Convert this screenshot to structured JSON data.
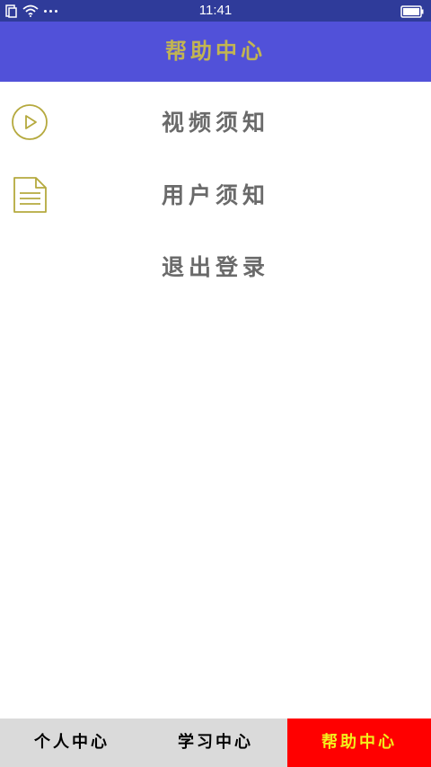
{
  "status_bar": {
    "time": "11:41",
    "icons": [
      "sim-icon",
      "wifi-icon",
      "more-dots-icon",
      "battery-icon"
    ]
  },
  "header": {
    "title": "帮助中心"
  },
  "menu": {
    "items": [
      {
        "label": "视频须知",
        "icon": "play-circle-icon"
      },
      {
        "label": "用户须知",
        "icon": "document-icon"
      },
      {
        "label": "退出登录",
        "icon": ""
      }
    ]
  },
  "tab_bar": {
    "tabs": [
      {
        "label": "个人中心",
        "active": false
      },
      {
        "label": "学习中心",
        "active": false
      },
      {
        "label": "帮助中心",
        "active": true
      }
    ]
  },
  "colors": {
    "status_bar_bg": "#2f3b9a",
    "header_bg": "#5151d9",
    "title_color": "#c2b552",
    "icon_color": "#b5a93e",
    "menu_text": "#6a6a6a",
    "tab_bg": "#dadada",
    "tab_active_bg": "#ff0000",
    "tab_active_text": "#f3ef1c"
  }
}
